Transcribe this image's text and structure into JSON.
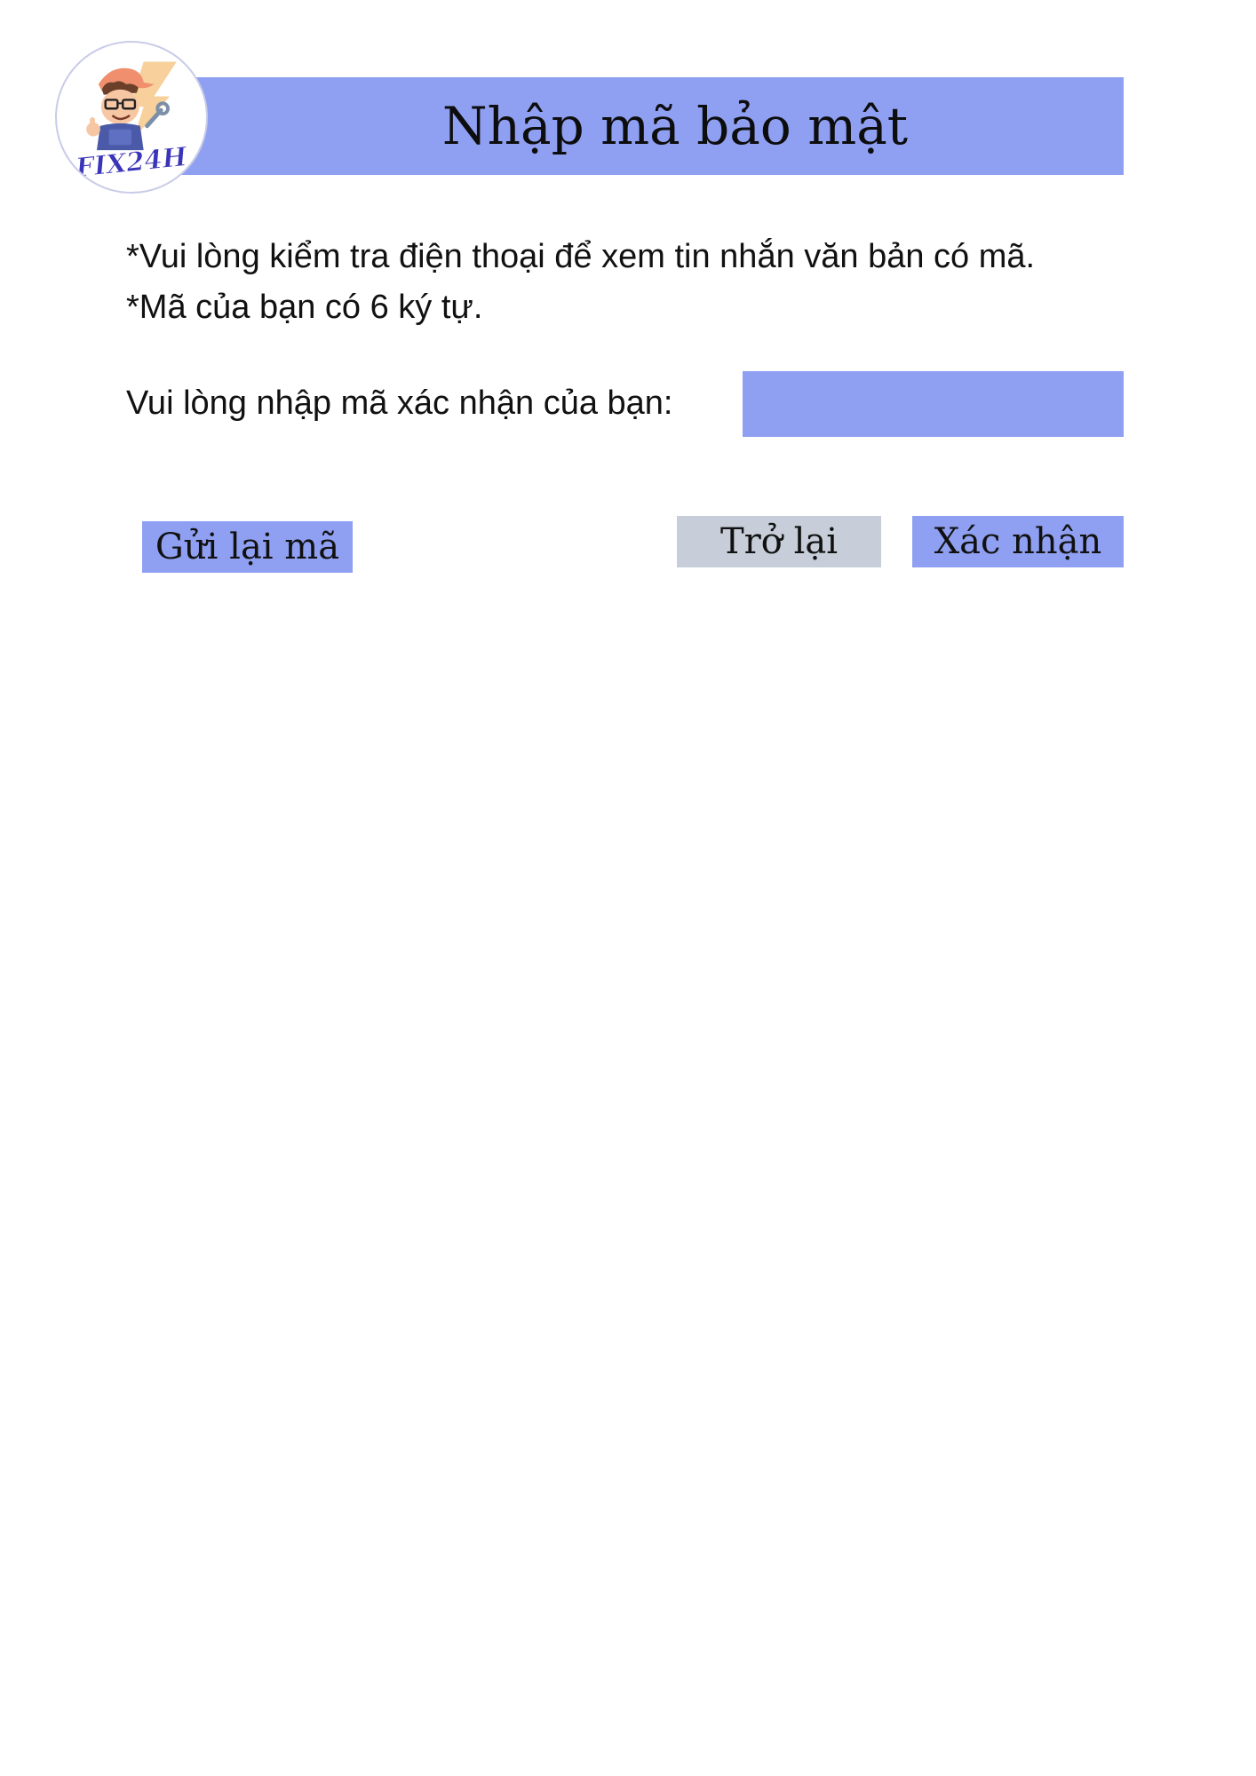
{
  "header": {
    "title": "Nhập mã bảo mật",
    "accent_color": "#8fa0f2"
  },
  "logo": {
    "text": "FIX24H",
    "icon": "mechanic-mascot-icon"
  },
  "instructions": {
    "line1": "*Vui lòng kiểm tra điện thoại để xem tin nhắn văn bản có mã.",
    "line2": "*Mã của bạn có 6 ký tự."
  },
  "code_field": {
    "label": "Vui lòng nhập mã xác nhận của bạn:",
    "value": "",
    "placeholder": ""
  },
  "actions": {
    "resend_label": "Gửi lại mã",
    "back_label": "Trở lại",
    "confirm_label": "Xác nhận"
  },
  "colors": {
    "primary": "#8fa0f2",
    "secondary": "#c7ced9"
  }
}
